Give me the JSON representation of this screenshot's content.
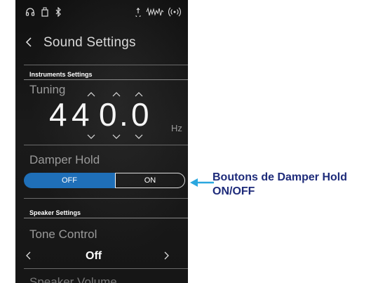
{
  "status_bar": {
    "icons": [
      "headphones-icon",
      "usb-icon",
      "bluetooth-icon",
      "audio-out-icon",
      "sound-wave-icon",
      "wifi-icon"
    ]
  },
  "header": {
    "back_icon": "chevron-left-icon",
    "title": "Sound Settings"
  },
  "instruments_settings": {
    "section_label": "Instruments Settings",
    "tuning": {
      "label": "Tuning",
      "digits": [
        "4",
        "4",
        "0",
        ".",
        "0"
      ],
      "unit": "Hz"
    },
    "damper_hold": {
      "label": "Damper Hold",
      "off_label": "OFF",
      "on_label": "ON",
      "selected": "OFF"
    }
  },
  "speaker_settings": {
    "section_label": "Speaker Settings",
    "tone_control": {
      "label": "Tone Control",
      "value": "Off"
    },
    "next_item_partial": "Speaker Volume"
  },
  "callout": {
    "line1": "Boutons de Damper Hold",
    "line2": "ON/OFF"
  },
  "colors": {
    "accent": "#1f6fb8",
    "callout_text": "#1e2b7a",
    "callout_line": "#2aa7df",
    "background": "#141414"
  }
}
